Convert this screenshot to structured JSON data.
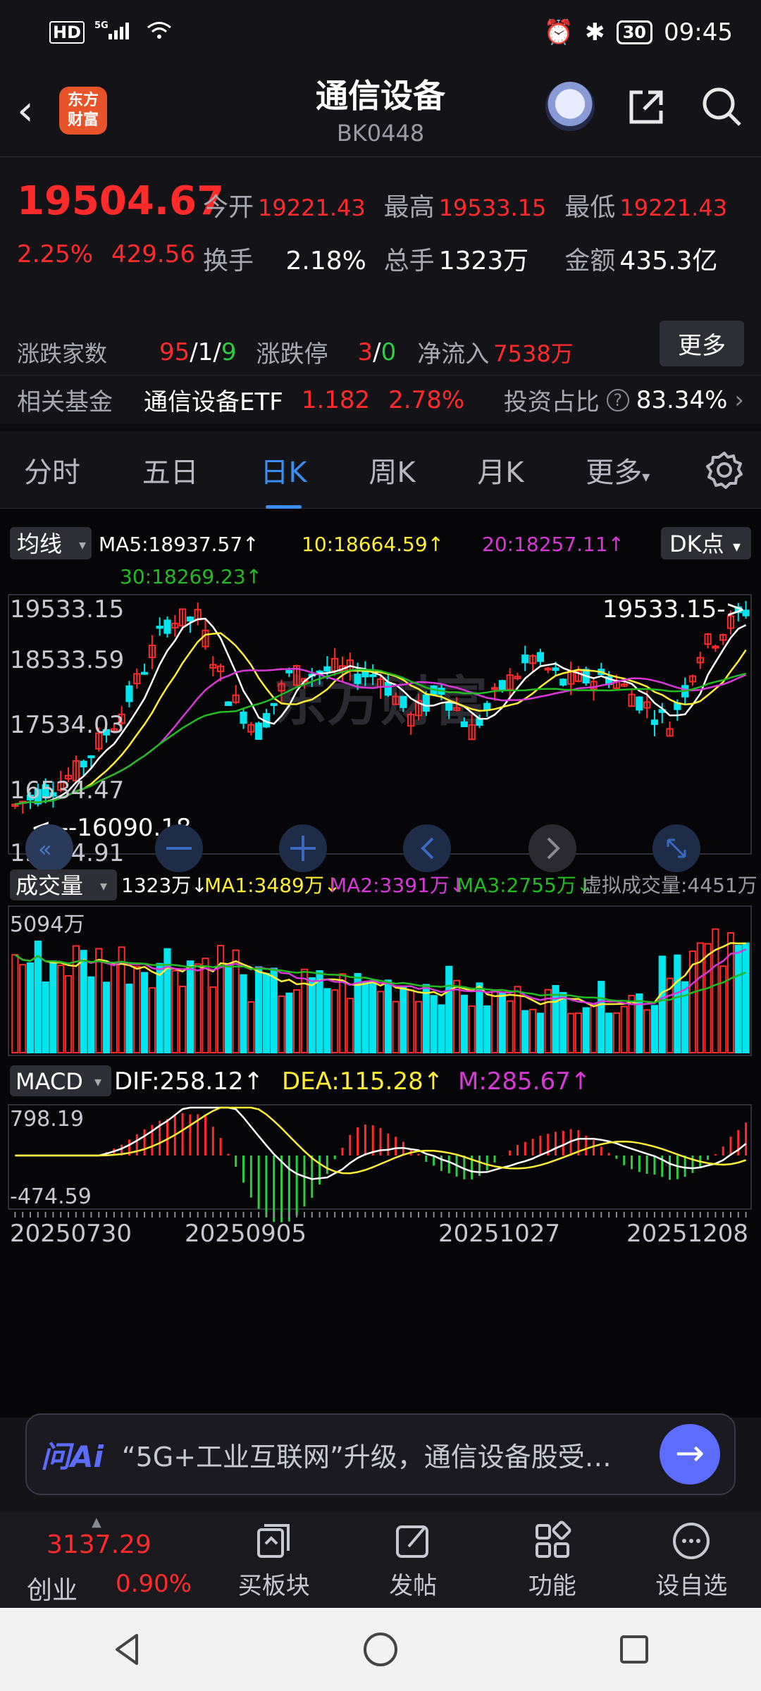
{
  "status": {
    "time": "09:45",
    "battery": "30",
    "net": "5G",
    "hd": "HD"
  },
  "header": {
    "logo_text": "东方\n财富",
    "title": "通信设备",
    "code": "BK0448"
  },
  "quote": {
    "price": "19504.67",
    "pct": "2.25%",
    "chg": "429.56",
    "open_label": "今开",
    "open": "19221.43",
    "high_label": "最高",
    "high": "19533.15",
    "low_label": "最低",
    "low": "19221.43",
    "turnover_label": "换手",
    "turnover": "2.18%",
    "volume_label": "总手",
    "volume": "1323万",
    "amount_label": "金额",
    "amount": "435.3亿",
    "breadth_label": "涨跌家数",
    "breadth_up": "95",
    "breadth_sep1": "/",
    "breadth_flat": "1",
    "breadth_sep2": "/",
    "breadth_down": "9",
    "limit_label": "涨跌停",
    "limit_up": "3",
    "limit_sep": "/",
    "limit_down": "0",
    "netflow_label": "净流入",
    "netflow": "7538万",
    "more_btn": "更多"
  },
  "fund": {
    "label": "相关基金",
    "name": "通信设备ETF",
    "price": "1.182",
    "pct": "2.78%",
    "ratio_label": "投资占比",
    "ratio": "83.34%"
  },
  "tabs": [
    "分时",
    "五日",
    "日K",
    "周K",
    "月K",
    "更多"
  ],
  "active_tab": 2,
  "indicators": {
    "ma_btn": "均线",
    "ma5": "MA5:18937.57↑",
    "ma10": "10:18664.59↑",
    "ma20": "20:18257.11↑",
    "ma30": "30:18269.23↑",
    "dk_btn": "DK点",
    "vol_btn": "成交量",
    "vol_today": "1323万↓",
    "vma1": "MA1:3489万↓",
    "vma2": "MA2:3391万↓",
    "vma3": "MA3:2755万↓",
    "virtual_vol": "虚拟成交量:4451万",
    "macd_btn": "MACD",
    "dif": "DIF:258.12↑",
    "dea": "DEA:115.28↑",
    "m": "M:285.67↑"
  },
  "chart_data": {
    "type": "candlestick",
    "y_ticks": [
      "19533.15",
      "18533.59",
      "17534.03",
      "16534.47",
      "15534.91"
    ],
    "max_marker": "19533.15->",
    "min_marker": "<---16090.18",
    "vol_axis": "5094万",
    "macd_axis_top": "798.19",
    "macd_axis_bottom": "-474.59",
    "x_ticks": [
      "20250730",
      "20250905",
      "20251027",
      "20251208"
    ],
    "watermark": "东方财富",
    "colors": {
      "up": "#ff2a2a",
      "down": "#00e5ee",
      "ma5": "#ffffff",
      "ma10": "#ffee33",
      "ma20": "#d838d8",
      "ma30": "#22bb22"
    }
  },
  "ai_bar": {
    "logo": "问Ai",
    "text": "“5G+工业互联网”升级，通信设备股受…"
  },
  "bottom_nav": {
    "index_value": "3137.29",
    "index_name": "创业",
    "index_pct": "0.90%",
    "items": [
      "买板块",
      "发帖",
      "功能",
      "设自选"
    ]
  }
}
